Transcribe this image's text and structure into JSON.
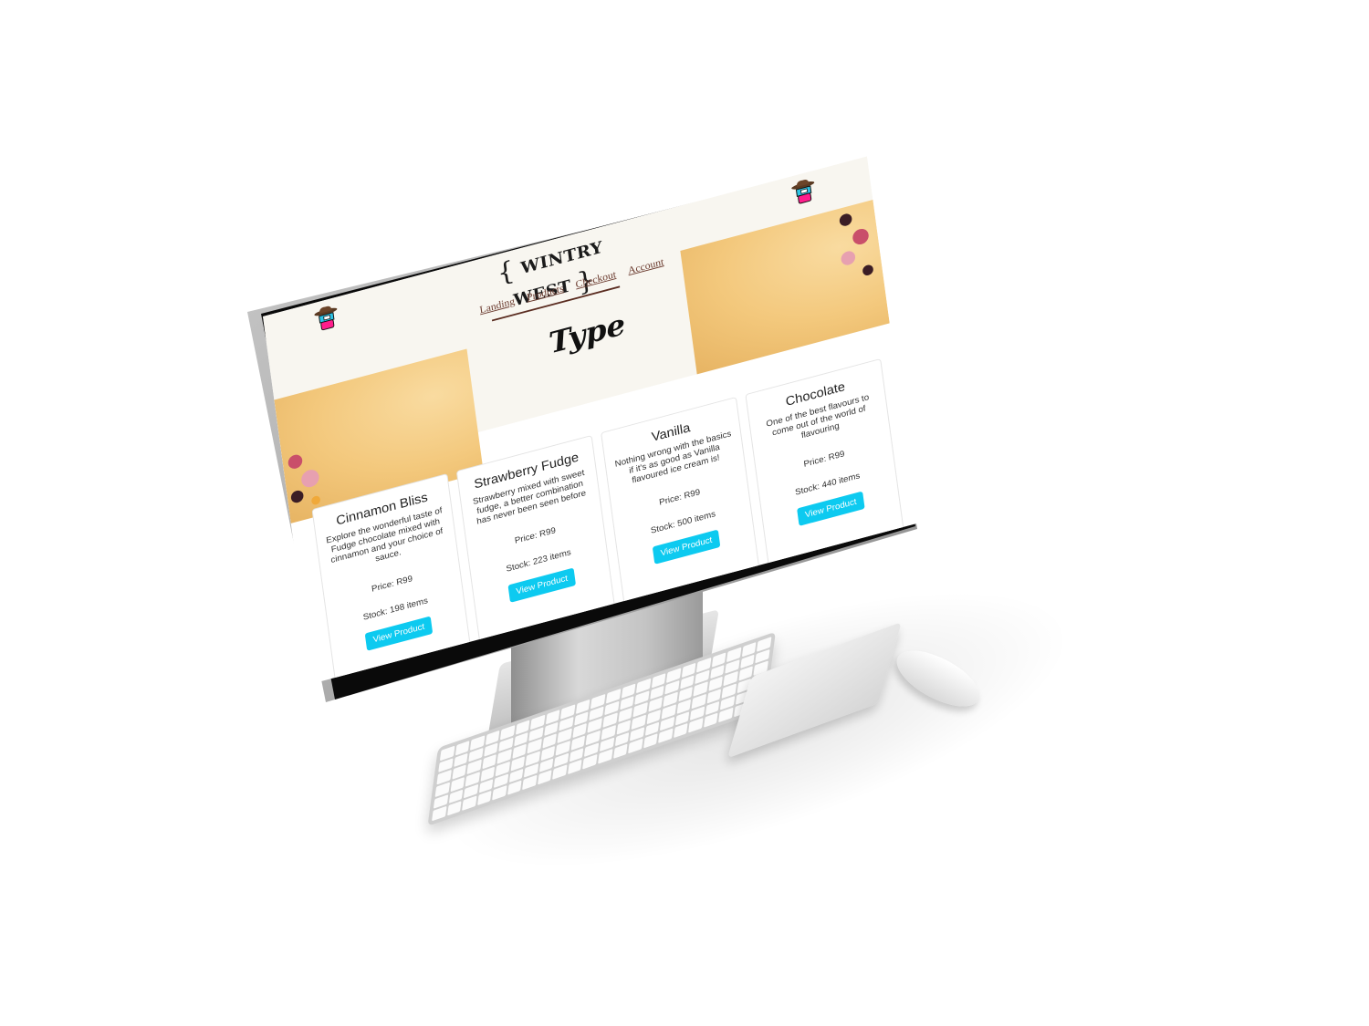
{
  "brand": {
    "name": "WINTRY WEST",
    "brace_open": "{",
    "brace_close": "}"
  },
  "nav": {
    "items": [
      "Landing",
      "Products",
      "Checkout",
      "Account"
    ]
  },
  "page": {
    "title": "Type"
  },
  "products": [
    {
      "name": "Cinnamon Bliss",
      "description": "Explore the wonderful taste of Fudge chocolate mixed with cinnamon and your choice of sauce.",
      "price": "Price: R99",
      "stock": "Stock: 198 items",
      "button": "View Product"
    },
    {
      "name": "Strawberry Fudge",
      "description": "Strawberry mixed with sweet fudge, a better combination has never been seen before",
      "price": "Price: R99",
      "stock": "Stock: 223 items",
      "button": "View Product"
    },
    {
      "name": "Vanilla",
      "description": "Nothing wrong with the basics if it's as good as Vanilla flavoured ice cream is!",
      "price": "Price: R99",
      "stock": "Stock: 500 items",
      "button": "View Product"
    },
    {
      "name": "Chocolate",
      "description": "One of the best flavours to come out of the world of flavouring",
      "price": "Price: R99",
      "stock": "Stock: 440 items",
      "button": "View Product"
    }
  ],
  "colors": {
    "accent_button": "#0dcaf0",
    "header_bg": "#f8f6f0",
    "nav_link": "#6b3b2f",
    "hero_gold": "#f3c87c"
  },
  "icons": [
    "ice-cream-cowboy-logo-icon"
  ]
}
